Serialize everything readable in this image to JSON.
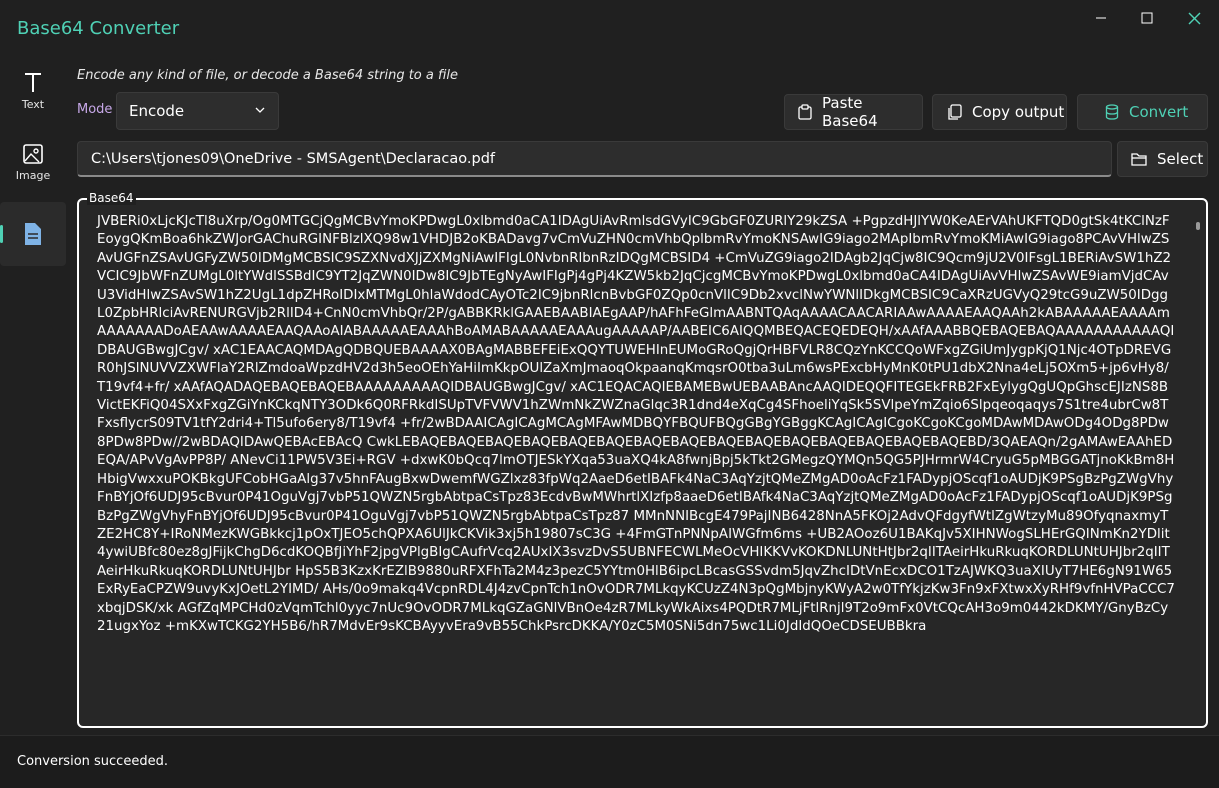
{
  "app": {
    "title": "Base64 Converter"
  },
  "nav": {
    "text_label": "Text",
    "image_label": "Image",
    "file_label": ""
  },
  "header": {
    "description": "Encode any kind of file, or decode a Base64 string to a file"
  },
  "mode": {
    "label": "Mode",
    "selected": "Encode"
  },
  "toolbar": {
    "paste_label": "Paste Base64",
    "copy_label": "Copy output",
    "convert_label": "Convert"
  },
  "file": {
    "path": "C:\\Users\\tjones09\\OneDrive - SMSAgent\\Declaracao.pdf",
    "select_label": "Select"
  },
  "output": {
    "label": "Base64",
    "text": "JVBERi0xLjcKJcTl8uXrp/Og0MTGCjQgMCBvYmoKPDwgL0xlbmd0aCA1IDAgUiAvRmlsdGVyIC9GbGF0ZURlY29kZSA\n+PgpzdHJlYW0KeAErVAhUKFTQD0gtSk4tKClNzFEoygQKmBoa6hkZWJorGAChuRGINFBlzlXQ98w1VHDJB2oKBADavg7vCmVuZHN0cmVhbQplbmRvYmoKNSAwIG9iago2MApIbmRvYmoKMiAwIG9iago8PCAvVHlwZSAvUGFnZSAvUGFyZW50IDMgMCBSIC9SZXNvdXJjZXMgNiAwIFIgL0NvbnRlbnRzIDQgMCBSID4\n+CmVuZG9iago2IDAgb2JqCjw8IC9Qcm9jU2V0IFsgL1BERiAvSW1hZ2VCIC9JbWFnZUMgL0ltYWdlSSBdIC9YT2JqZWN0IDw8IC9JbTEgNyAwIFIgPj4gPj4KZW5kb2JqCjcgMCBvYmoKPDwgL0xlbmd0aCA4IDAgUiAvVHlwZSAvWE9iamVjdCAvU3VidHlwZSAvSW1hZ2UgL1dpZHRoIDIxMTMgL0hlaWdodCAyOTc2IC9jbnRlcnBvbGF0ZQp0cnVlIC9Db2xvclNwYWNlIDkgMCBSIC9CaXRzUGVyQ29tcG9uZW50IDggL0ZpbHRlciAvRENURGVjb2RlID4+CnN0cmVhbQr/2P/gABBKRklGAAEBAABIAEgAAP/hAFhFeGlmAABNTQAqAAAACAACARIAAwAAAAEAAQAAh2kABAAAAAEAAAAmAAAAAAADoAEAAwAAAAEAAQAAoAIABAAAAAEAAAhBoAMABAAAAAEAAAugAAAAAP/AABEIC6AIQQMBEQACEQEDEQH/xAAfAAABBQEBAQEBAQAAAAAAAAAAAQIDBAUGBwgJCgv/\nxAC1EAACAQMDAgQDBQUEBAAAAX0BAgMABBEFEiExQQYTUWEHInEUMoGRoQgjQrHBFVLR8CQzYnKCCQoWFxgZGiUmJygpKjQ1Njc4OTpDREVGR0hJSlNUVVZXWFlaY2RlZmdoaWpzdHV2d3h5eoOEhYaHiImKkpOUlZaXmJmaoqOkpaanqKmqsrO0tba3uLm6wsPExcbHyMnK0tPU1dbX2Nna4eLj5OXm5+jp6vHy8/T19vf4+fr/\nxAAfAQADAQEBAQEBAQEBAAAAAAAAAQIDBAUGBwgJCgv/\nxAC1EQACAQIEBAMEBwUEBAABAncAAQIDEQQFITEGEkFRB2FxEylygQgUQpGhscEJIzNS8BVictEKFiQ04SXxFxgZGiYnKCkqNTY3ODk6Q0RFRkdISUpTVFVWV1hZWmNkZWZnaGlqc3R1dnd4eXqCg4SFhoeliYqSk5SVlpeYmZqio6Slpqeoqaqys7S1tre4ubrCw8TFxsflycrS09TV1tfY2dri4+Tl5ufo6ery8/T19vf4\n+fr/2wBDAAICAgICAgMCAgMFAwMDBQYFBQUFBQgGBgYGBggKCAgICAgICgoKCgoKCgoMDAwMDAwODg4ODg8PDw8PDw8PDw//2wBDAQIDAwQEBAcEBAcQ CwkLEBAQEBAQEBAQEBAQEBAQEBAQEBAQEBAQEBAQEBAQEBAQEBAQEBAQEBAQEBAQEBD/3QAEAQn/2gAMAwEAAhEDEQA/APvVgAvPP8P/\nANevCi11PW5V3Ei+RGV\n+dxwK0bQcq7lmOTJESkYXqa53uaXQ4kA8fwnjBpj5kTkt2GMegzQYMQn5QG5PJHrmrW4CryuG5pMBGGATjnoKkBm8HHbigVwxxuPOKBkgUFCobHGaAlg37v5hnFAugBxwDwemfWGZlxz83fpWq2AaeD6etIBAFk4NaC3AqYzjtQMeZMgAD0oAcFz1FADypjOScqf1oAUDjK9PSgBzPgZWgVhyFnBYjOf6UDJ95cBvur0P41OguVgj7vbP51QWZN5rgbAbtpaCsTpz83EcdvBwMWhrtlXIzfp8aaeD6etIBAfk4NaC3AqYzjtQMeZMgAD0oAcFz1FADypjOScqf1oAUDjK9PSgBzPgZWgVhyFnBYjOf6UDJ95cBvur0P41OguVgj7vbP51QWZN5rgbAbtpaCsTpz87\nMMnNNIBcgE479PajINB6428NnA5FKOj2AdvQFdgyfWtlZgWtzyMu89OfyqnaxmyTZE2HC8Y+IRoNMezKWGBkkcj1pOxTJEO5chQPXA6UlJkCKVik3xj5h19807sC3G\n+4FmGTnPNNpAIWGfm6ms\n+UB2AOoz6U1BAKqJv5XIHNWogSLHErGQINmKn2YDlit4ywiUBfc80ez8gJFijkChgD6cdKOQBfJiYhF2jpgVPlgBIgCAufrVcq2AUxIX3svzDvS5UBNFECWLMeOcVHIKKVvKOKDNLUNtHtJbr2qIITAeirHkuRkuqKORDLUNtUHJbr2qIITAeirHkuRkuqKORDLUNtUHJbr\nHpS5B3KzxKrEZlB9880uRFXFhTa2M4z3pezC5YYtm0HlB6ipcLBcasGSSvdm5JqvZhcIDtVnEcxDCO1TzAJWKQ3uaXIUyT7HE6gN91W65ExRyEaCPZW9uvyKxJOetL2YIMD/\nAHs/0o9makq4VcpnRDL4J4zvCpnTch1nOvODR7MLkqyKCUzZ4N3pQgMbjnyKWyA2w0TfYkjzKw3Fn9xFXtwxXyRHf9vfnHVPaCCC7xbqjDSK/xk\nAGfZqMPCHd0zVqmTchl0yyc7nUc9OvODR7MLkqGZaGNlVBnOe4zR7MLkyWkAixs4PQDtR7MLjFtlRnjl9T2o9mFx0VtCQcAH3o9m0442kDKMY/GnyBzCy21ugxYoz\n+mKXwTCKG2YH5B6/hR7MdvEr9sKCBAyyvEra9vB55ChkPsrcDKKA/Y0zC5M0SNi5dn75wc1Li0JdIdQOeCDSEUBBkra",
    "scrollbar_label": ""
  },
  "status": {
    "message": "Conversion succeeded."
  },
  "colors": {
    "accent": "#4fd1b5",
    "mode_label": "#c7a8e8",
    "background": "#202020"
  },
  "icons": {
    "minimize": "minimize-icon",
    "maximize": "maximize-icon",
    "close": "close-icon",
    "text_nav": "text-icon",
    "image_nav": "image-icon",
    "file_nav": "file-icon",
    "paste": "paste-icon",
    "copy": "copy-icon",
    "convert": "convert-icon",
    "folder": "folder-icon",
    "chevron": "chevron-down-icon"
  }
}
